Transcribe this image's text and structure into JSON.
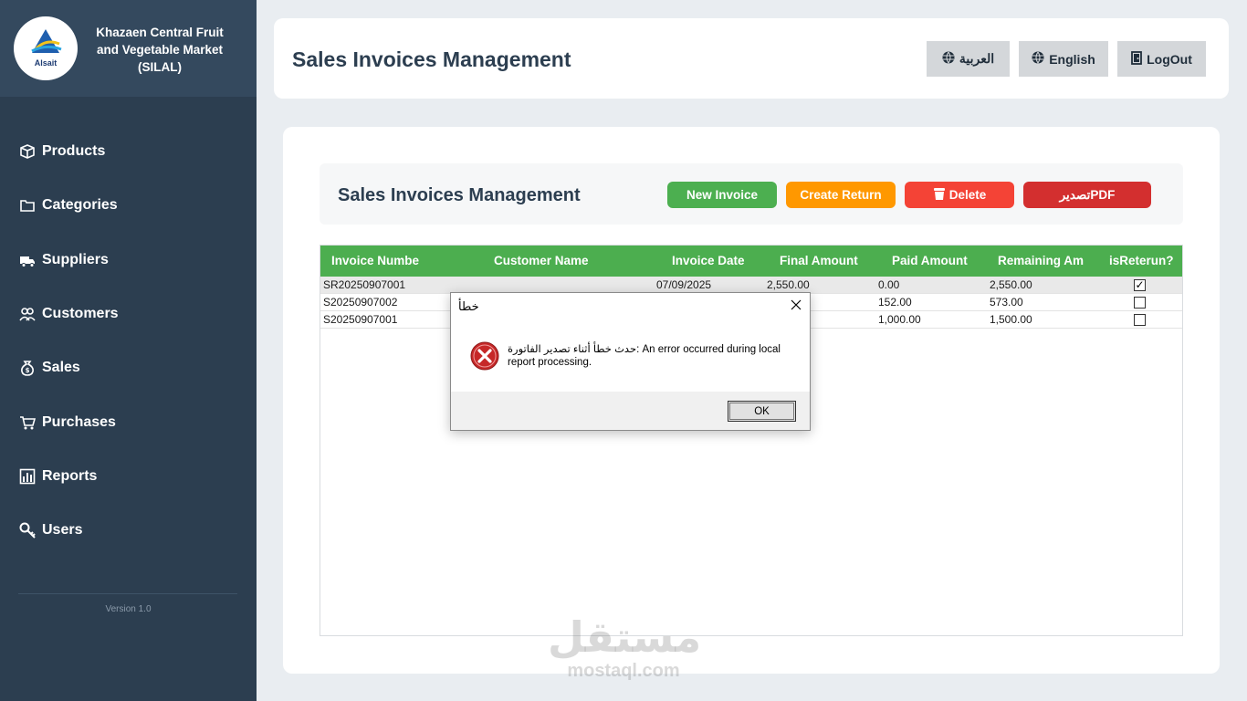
{
  "sidebar": {
    "logo_text": "Alsait",
    "org_name": "Khazaen Central Fruit and Vegetable Market (SILAL)",
    "items": [
      {
        "label": "Products",
        "icon": "box-icon"
      },
      {
        "label": "Categories",
        "icon": "folder-icon"
      },
      {
        "label": "Suppliers",
        "icon": "truck-icon"
      },
      {
        "label": "Customers",
        "icon": "users-icon"
      },
      {
        "label": "Sales",
        "icon": "money-bag-icon"
      },
      {
        "label": "Purchases",
        "icon": "cart-icon"
      },
      {
        "label": "Reports",
        "icon": "chart-icon"
      },
      {
        "label": "Users",
        "icon": "key-icon"
      }
    ],
    "version": "Version 1.0"
  },
  "header": {
    "title": "Sales Invoices Management",
    "arabic_label": "العربية",
    "english_label": "English",
    "logout_label": "LogOut"
  },
  "toolbar": {
    "title": "Sales Invoices Management",
    "new_invoice": "New Invoice",
    "create_return": "Create Return",
    "delete": "Delete",
    "export_pdf": "تصديرPDF"
  },
  "grid": {
    "columns": [
      "Invoice Numbe",
      "Customer Name",
      "Invoice Date",
      "Final Amount",
      "Paid Amount",
      "Remaining Am",
      "isReterun?"
    ],
    "rows": [
      {
        "invoice_number": "SR20250907001",
        "customer": "",
        "date": "07/09/2025",
        "final": "2,550.00",
        "paid": "0.00",
        "remaining": "2,550.00",
        "is_return": true
      },
      {
        "invoice_number": "S20250907002",
        "customer": "",
        "date": "",
        "final": "",
        "paid": "152.00",
        "remaining": "573.00",
        "is_return": false
      },
      {
        "invoice_number": "S20250907001",
        "customer": "",
        "date": "",
        "final": "",
        "paid": "1,000.00",
        "remaining": "1,500.00",
        "is_return": false
      }
    ]
  },
  "dialog": {
    "title": "خطأ",
    "message": "حدث خطأ أثناء تصدير الفاتورة: An error occurred during local report processing.",
    "ok_label": "OK"
  },
  "watermark": {
    "arabic": "مستقل",
    "latin": "mostaql.com"
  },
  "colors": {
    "sidebar": "#2c3e50",
    "grid_header": "#4cae4f",
    "new_invoice": "#4caf50",
    "create_return": "#ff9800",
    "delete": "#f44336",
    "export": "#d32f2f"
  }
}
